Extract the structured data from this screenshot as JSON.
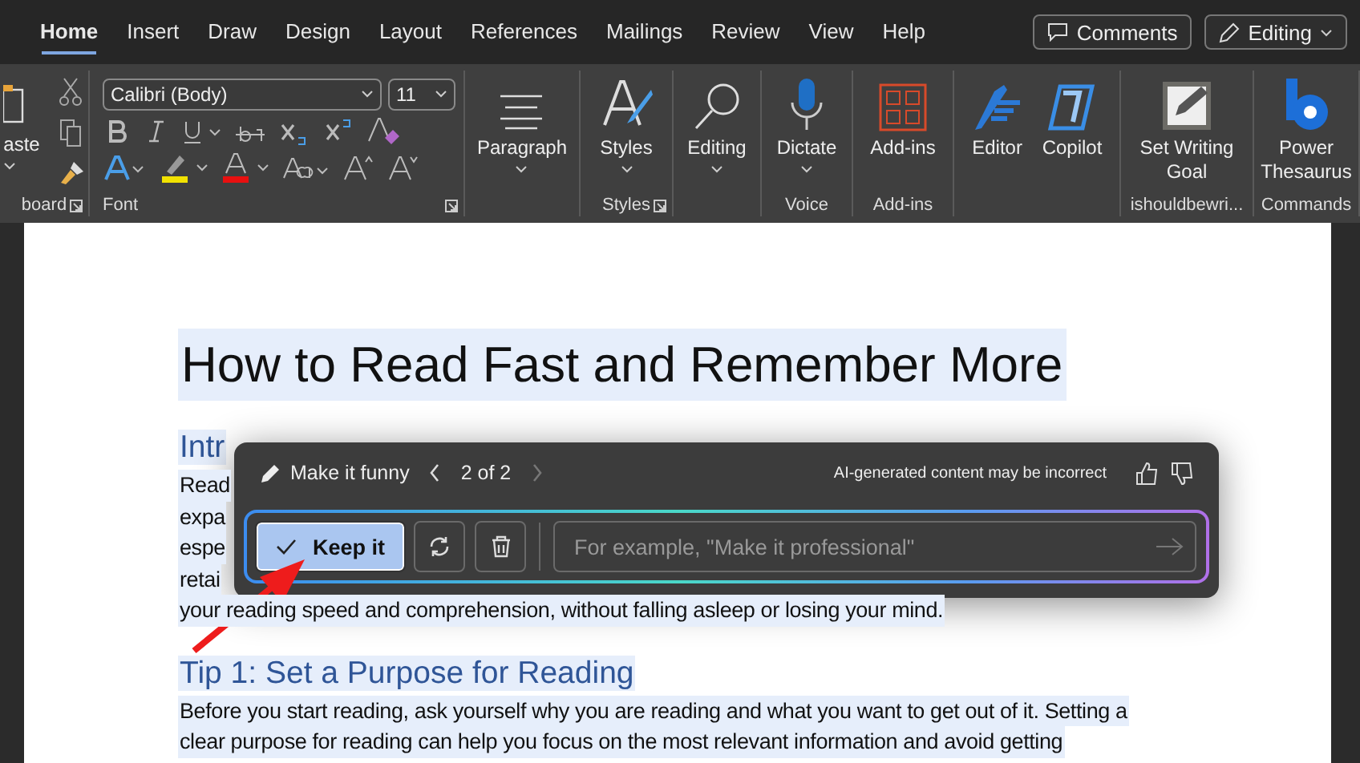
{
  "tabs": [
    {
      "label": "Home",
      "selected": true
    },
    {
      "label": "Insert",
      "selected": false
    },
    {
      "label": "Draw",
      "selected": false
    },
    {
      "label": "Design",
      "selected": false
    },
    {
      "label": "Layout",
      "selected": false
    },
    {
      "label": "References",
      "selected": false
    },
    {
      "label": "Mailings",
      "selected": false
    },
    {
      "label": "Review",
      "selected": false
    },
    {
      "label": "View",
      "selected": false
    },
    {
      "label": "Help",
      "selected": false
    }
  ],
  "title_buttons": [
    {
      "kind": "comments",
      "label": "Comments"
    },
    {
      "kind": "mode",
      "label": "Editing"
    }
  ],
  "ribbon": {
    "groups": [
      {
        "kind": "clipboard",
        "label": "board",
        "launcher": true,
        "paste_label": "aste"
      },
      {
        "kind": "font",
        "label": "Font",
        "launcher": true,
        "font_name": "Calibri (Body)",
        "font_size": "11"
      },
      {
        "kind": "big",
        "buttons": [
          {
            "label": "Paragraph",
            "dropdown": true
          }
        ]
      },
      {
        "kind": "big",
        "label": "Styles",
        "launcher": true,
        "buttons": [
          {
            "label": "Styles",
            "dropdown": true
          }
        ]
      },
      {
        "kind": "big",
        "buttons": [
          {
            "label": "Editing",
            "dropdown": true
          }
        ]
      },
      {
        "kind": "big",
        "label": "Voice",
        "buttons": [
          {
            "label": "Dictate",
            "dropdown": true
          }
        ]
      },
      {
        "kind": "big",
        "label": "Add-ins",
        "buttons": [
          {
            "label": "Add-ins"
          }
        ]
      },
      {
        "kind": "big",
        "buttons": [
          {
            "label": "Editor"
          },
          {
            "label": "Copilot"
          }
        ]
      },
      {
        "kind": "big",
        "label": "ishouldbewri...",
        "buttons": [
          {
            "label": "Set Writing Goal"
          }
        ]
      },
      {
        "kind": "big",
        "label": "Commands",
        "buttons": [
          {
            "label": "Power Thesaurus"
          }
        ]
      }
    ]
  },
  "document": {
    "highlighted": true,
    "blocks": [
      {
        "kind": "title",
        "text": "How to Read Fast and Remember More"
      },
      {
        "kind": "heading",
        "text": "Intr"
      },
      {
        "kind": "para",
        "lines": [
          "Read",
          "expa",
          "espe",
          "retai",
          "your reading speed and comprehension, without falling asleep or losing your mind."
        ]
      },
      {
        "kind": "heading",
        "text": "Tip 1: Set a Purpose for Reading"
      },
      {
        "kind": "para",
        "lines": [
          "Before you start reading, ask yourself why you are reading and what you want to get out of it. Setting a",
          "clear purpose for reading can help you focus on the most relevant information and avoid getting"
        ]
      }
    ]
  },
  "popup": {
    "prompt": "Make it funny",
    "pager": "2 of 2",
    "prev_disabled": false,
    "next_disabled": true,
    "disclaimer": "AI-generated content may be incorrect",
    "keep_label": "Keep it",
    "placeholder": "For example, \"Make it professional\""
  }
}
